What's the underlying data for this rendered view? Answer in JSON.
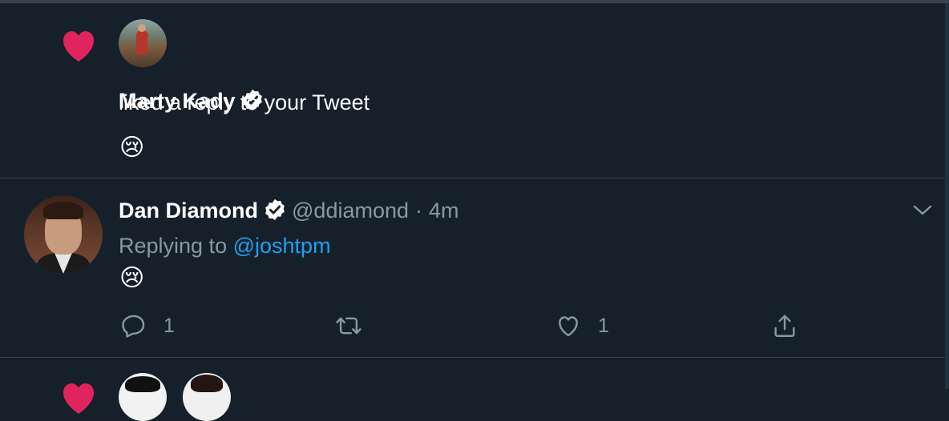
{
  "notification": {
    "user_name": "Marty Kady",
    "action_text": "liked a reply to your Tweet",
    "emoji": "😢"
  },
  "tweet": {
    "author_name": "Dan Diamond",
    "handle": "@ddiamond",
    "separator": "·",
    "time": "4m",
    "replying_prefix": "Replying to",
    "replying_to": "@joshtpm",
    "emoji": "😢",
    "reply_count": "1",
    "like_count": "1"
  },
  "icons": {
    "like_notification": "heart-icon",
    "verified": "verified-badge-icon",
    "more": "chevron-down-icon",
    "reply": "reply-icon",
    "retweet": "retweet-icon",
    "like": "like-icon",
    "share": "share-icon"
  },
  "colors": {
    "background": "#15202b",
    "heart": "#e0245e",
    "secondary_text": "#8899a6",
    "link": "#1da1f2",
    "divider": "#38444d"
  }
}
